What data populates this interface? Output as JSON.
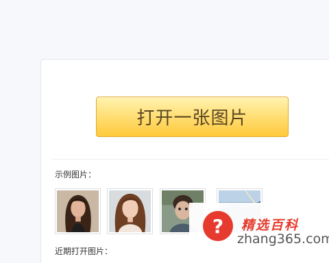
{
  "main": {
    "open_button_label": "打开一张图片",
    "examples_label": "示例图片：",
    "recent_label": "近期打开图片："
  },
  "examples": [
    {
      "icon": "portrait-woman-dark-hair-thumbnail"
    },
    {
      "icon": "portrait-woman-auburn-hair-thumbnail"
    },
    {
      "icon": "portrait-child-thumbnail"
    },
    {
      "icon": "landscape-sky-thumbnail"
    }
  ],
  "watermark": {
    "badge": "?",
    "title": "精选百科",
    "site": "zhang365.com"
  },
  "colors": {
    "button_top": "#fff3b0",
    "button_bottom": "#ffc93a",
    "button_text": "#5b4621",
    "watermark_red": "#e63a2e"
  }
}
